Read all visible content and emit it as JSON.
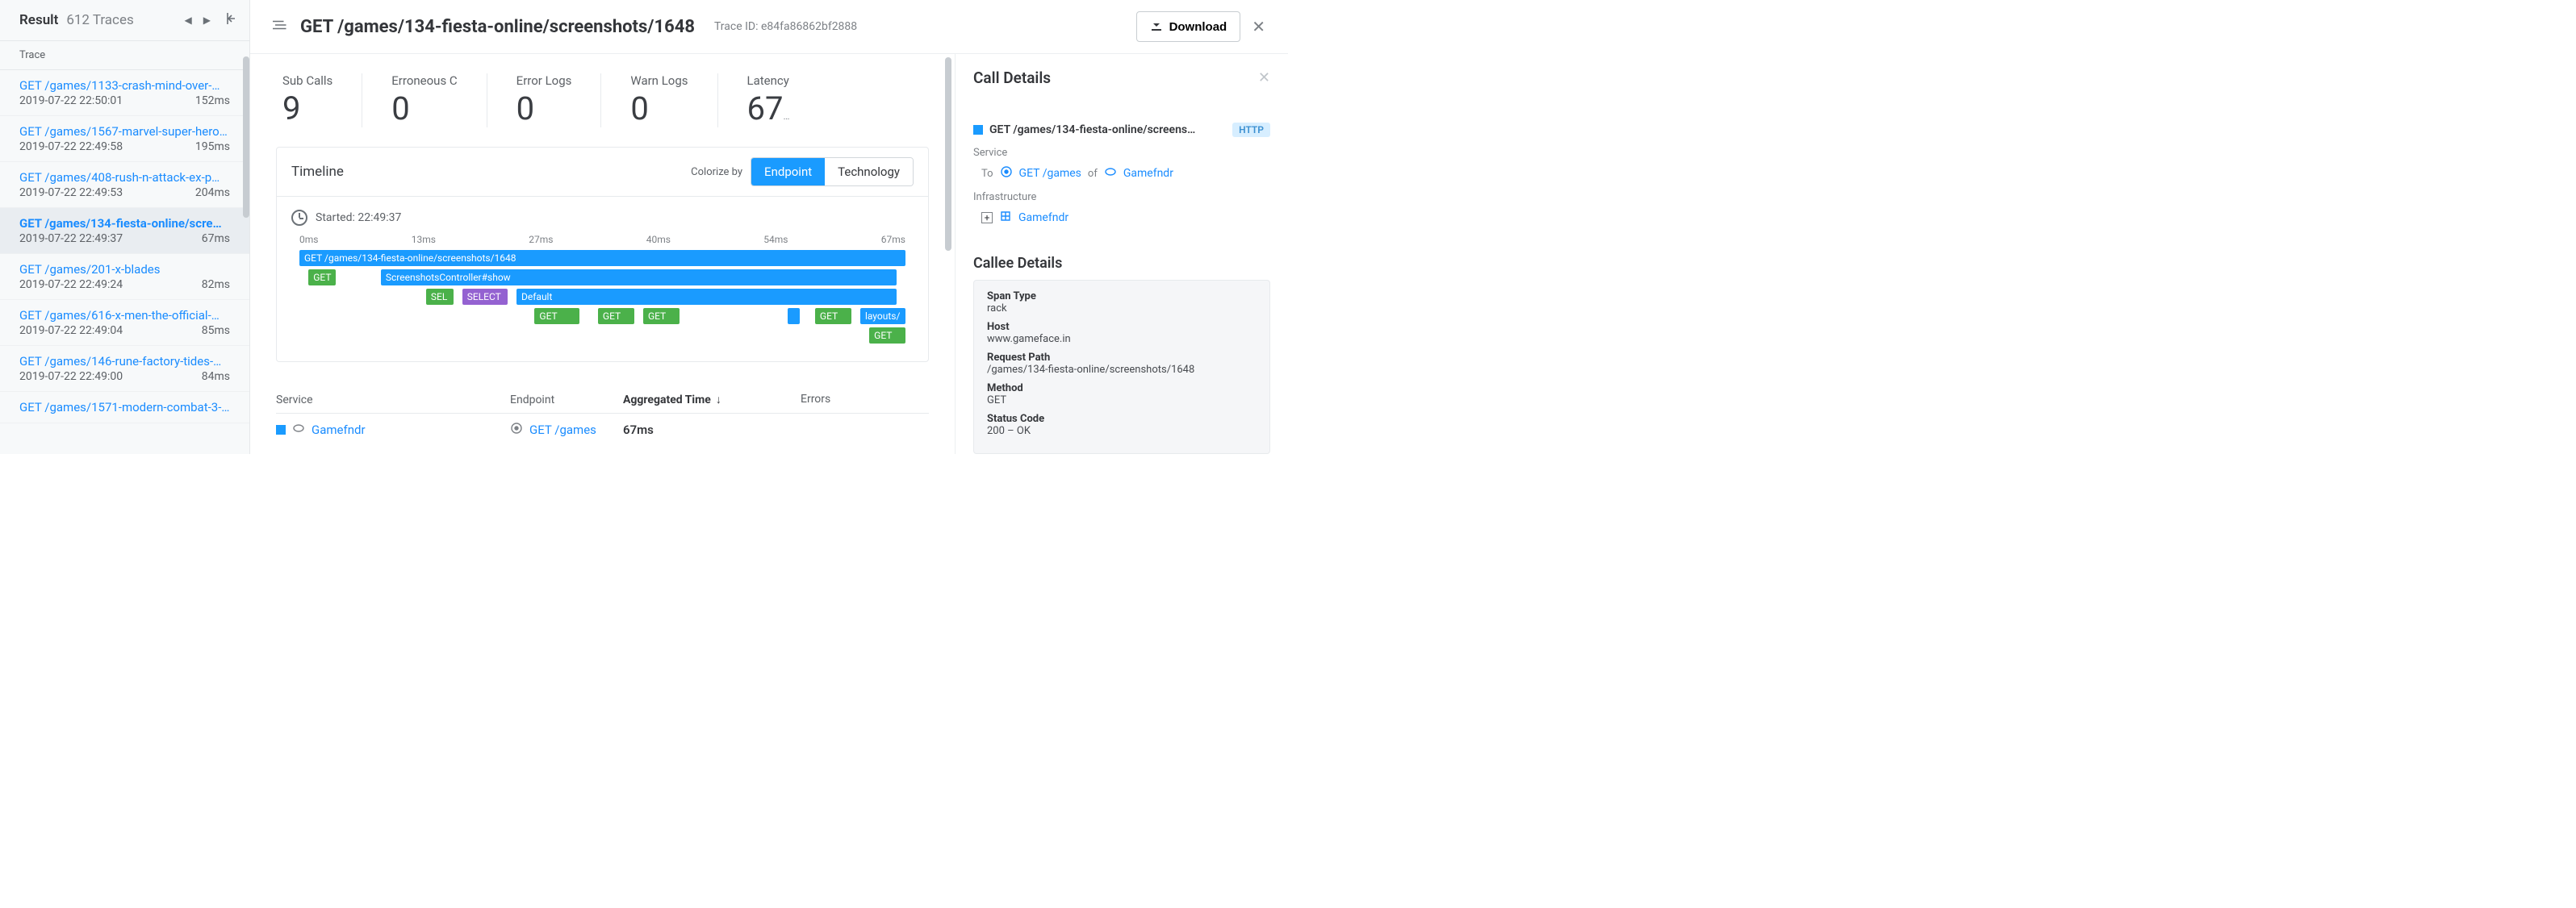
{
  "sidebar": {
    "title": "Result",
    "subtitle": "612 Traces",
    "column_header": "Trace",
    "items": [
      {
        "title": "GET /games/1133-crash-mind-over-…",
        "ts": "2019-07-22 22:50:01",
        "dur": "152ms",
        "selected": false
      },
      {
        "title": "GET /games/1567-marvel-super-hero…",
        "ts": "2019-07-22 22:49:58",
        "dur": "195ms",
        "selected": false
      },
      {
        "title": "GET /games/408-rush-n-attack-ex-p…",
        "ts": "2019-07-22 22:49:53",
        "dur": "204ms",
        "selected": false
      },
      {
        "title": "GET /games/134-fiesta-online/scre…",
        "ts": "2019-07-22 22:49:37",
        "dur": "67ms",
        "selected": true
      },
      {
        "title": "GET /games/201-x-blades",
        "ts": "2019-07-22 22:49:24",
        "dur": "82ms",
        "selected": false
      },
      {
        "title": "GET /games/616-x-men-the-official-…",
        "ts": "2019-07-22 22:49:04",
        "dur": "85ms",
        "selected": false
      },
      {
        "title": "GET /games/146-rune-factory-tides-…",
        "ts": "2019-07-22 22:49:00",
        "dur": "84ms",
        "selected": false
      },
      {
        "title": "GET /games/1571-modern-combat-3-…",
        "ts": "",
        "dur": "",
        "selected": false
      }
    ]
  },
  "header": {
    "title": "GET /games/134-fiesta-online/screenshots/1648",
    "trace_id_label": "Trace ID: e84fa86862bf2888",
    "download": "Download"
  },
  "stats": [
    {
      "label": "Sub Calls",
      "value": "9",
      "unit": ""
    },
    {
      "label": "Erroneous C",
      "value": "0",
      "unit": ""
    },
    {
      "label": "Error Logs",
      "value": "0",
      "unit": ""
    },
    {
      "label": "Warn Logs",
      "value": "0",
      "unit": ""
    },
    {
      "label": "Latency",
      "value": "67",
      "unit": "…"
    }
  ],
  "timeline": {
    "title": "Timeline",
    "colorize_label": "Colorize by",
    "toggle": {
      "a": "Endpoint",
      "b": "Technology"
    },
    "started_label": "Started: 22:49:37",
    "axis": [
      "0ms",
      "13ms",
      "27ms",
      "40ms",
      "54ms",
      "67ms"
    ]
  },
  "chart_data": {
    "type": "gantt",
    "x_unit": "ms",
    "xlim": [
      0,
      67
    ],
    "ticks": [
      0,
      13,
      27,
      40,
      54,
      67
    ],
    "rows": [
      {
        "row": 0,
        "start": 0,
        "end": 67,
        "label": "GET /games/134-fiesta-online/screenshots/1648",
        "color": "blue"
      },
      {
        "row": 1,
        "start": 1,
        "end": 4,
        "label": "GET",
        "color": "green"
      },
      {
        "row": 1,
        "start": 9,
        "end": 66,
        "label": "ScreenshotsController#show",
        "color": "blue"
      },
      {
        "row": 2,
        "start": 14,
        "end": 17,
        "label": "SEL",
        "color": "green"
      },
      {
        "row": 2,
        "start": 18,
        "end": 23,
        "label": "SELECT",
        "color": "purple"
      },
      {
        "row": 2,
        "start": 24,
        "end": 66,
        "label": "Default",
        "color": "blue"
      },
      {
        "row": 3,
        "start": 26,
        "end": 31,
        "label": "GET",
        "color": "green"
      },
      {
        "row": 3,
        "start": 33,
        "end": 37,
        "label": "GET",
        "color": "green"
      },
      {
        "row": 3,
        "start": 38,
        "end": 42,
        "label": "GET",
        "color": "green"
      },
      {
        "row": 3,
        "start": 54,
        "end": 55,
        "label": "",
        "color": "blue"
      },
      {
        "row": 3,
        "start": 57,
        "end": 61,
        "label": "GET",
        "color": "green"
      },
      {
        "row": 3,
        "start": 62,
        "end": 67,
        "label": "layouts/",
        "color": "blue"
      },
      {
        "row": 4,
        "start": 63,
        "end": 67,
        "label": "GET",
        "color": "green"
      }
    ]
  },
  "agg": {
    "headers": {
      "service": "Service",
      "endpoint": "Endpoint",
      "time": "Aggregated Time",
      "errors": "Errors"
    },
    "rows": [
      {
        "service": "Gamefndr",
        "endpoint": "GET /games",
        "time": "67ms"
      }
    ]
  },
  "details": {
    "title": "Call Details",
    "main_line": "GET /games/134-fiesta-online/screens…",
    "http_badge": "HTTP",
    "service_label": "Service",
    "to": "To",
    "service_link": "GET /games",
    "of": "of",
    "service_name": "Gamefndr",
    "infra_label": "Infrastructure",
    "infra_link": "Gamefndr",
    "callee_title": "Callee Details",
    "callee": [
      {
        "k": "Span Type",
        "v": "rack"
      },
      {
        "k": "Host",
        "v": "www.gameface.in"
      },
      {
        "k": "Request Path",
        "v": "/games/134-fiesta-online/screenshots/1648"
      },
      {
        "k": "Method",
        "v": "GET"
      },
      {
        "k": "Status Code",
        "v": "200 – OK"
      }
    ]
  }
}
